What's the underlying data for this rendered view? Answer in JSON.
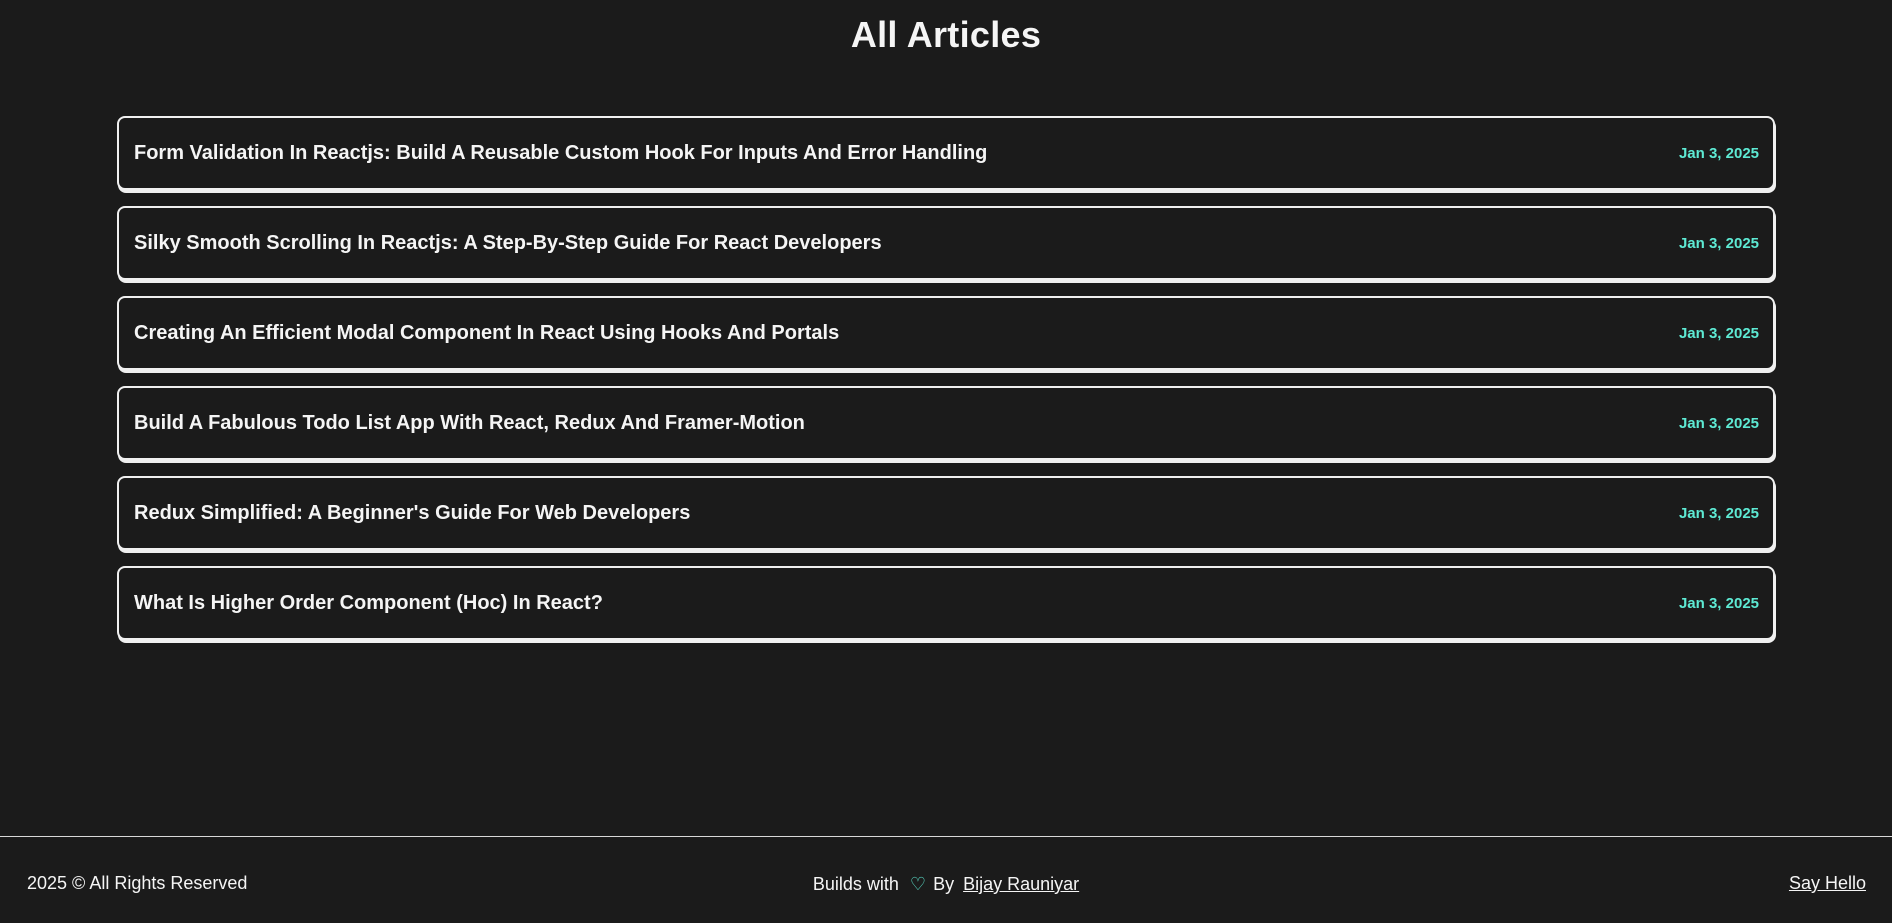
{
  "page": {
    "title": "All Articles"
  },
  "articles": [
    {
      "title": "Form Validation In Reactjs: Build A Reusable Custom Hook For Inputs And Error Handling",
      "date": "Jan 3, 2025"
    },
    {
      "title": "Silky Smooth Scrolling In Reactjs: A Step-By-Step Guide For React Developers",
      "date": "Jan 3, 2025"
    },
    {
      "title": "Creating An Efficient Modal Component In React Using Hooks And Portals",
      "date": "Jan 3, 2025"
    },
    {
      "title": "Build A Fabulous Todo List App With React, Redux And Framer-Motion",
      "date": "Jan 3, 2025"
    },
    {
      "title": "Redux Simplified: A Beginner's Guide For Web Developers",
      "date": "Jan 3, 2025"
    },
    {
      "title": "What Is Higher Order Component (Hoc) In React?",
      "date": "Jan 3, 2025"
    }
  ],
  "footer": {
    "copyright": "2025 © All Rights Reserved",
    "builds_with": "Builds with",
    "heart_icon": "heart-icon",
    "by": "By",
    "author": "Bijay Rauniyar",
    "say_hello": "Say Hello"
  },
  "colors": {
    "background": "#1b1b1b",
    "text": "#f5f5f5",
    "accent": "#5eead4",
    "border": "#f0f0f0"
  }
}
